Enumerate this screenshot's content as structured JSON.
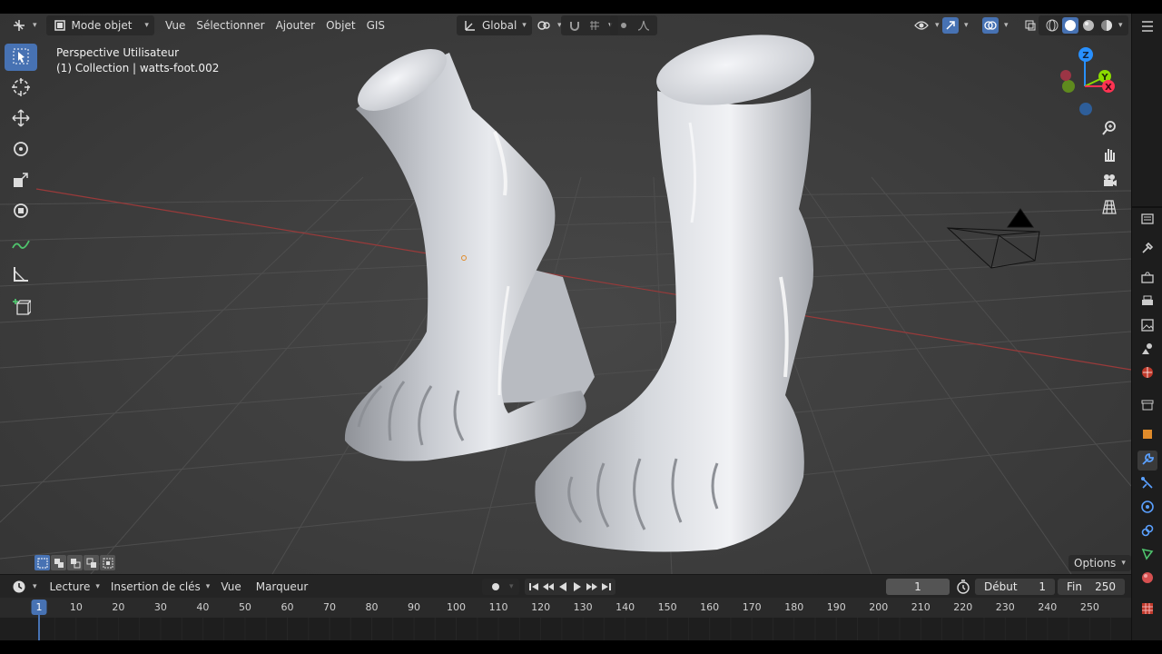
{
  "header": {
    "editor_type_icon": "axis-editor-icon",
    "mode_label": "Mode objet",
    "menus": [
      "Vue",
      "Sélectionner",
      "Ajouter",
      "Objet",
      "GIS"
    ],
    "transform_orientation": "Global"
  },
  "viewport": {
    "view_name": "Perspective Utilisateur",
    "collection_info": "(1) Collection | watts-foot.002",
    "options_label": "Options",
    "gizmo_axes": {
      "z": "Z",
      "y": "Y",
      "x": "X"
    }
  },
  "toolbar": {
    "tools": [
      "select-box-icon",
      "cursor-icon",
      "move-icon",
      "rotate-icon",
      "scale-icon",
      "transform-icon",
      "annotate-icon",
      "measure-icon",
      "add-cube-icon"
    ]
  },
  "timeline": {
    "menus": [
      "Lecture",
      "Insertion de clés",
      "Vue",
      "Marqueur"
    ],
    "current_frame": "1",
    "start_label": "Début",
    "start_value": "1",
    "end_label": "Fin",
    "end_value": "250",
    "ruler_ticks": [
      "10",
      "20",
      "30",
      "40",
      "50",
      "60",
      "70",
      "80",
      "90",
      "100",
      "110",
      "120",
      "130",
      "140",
      "150",
      "160",
      "170",
      "180",
      "190",
      "200",
      "210",
      "220",
      "230",
      "240",
      "250"
    ],
    "current_frame_marker": "1"
  },
  "colors": {
    "accent": "#4772b3",
    "axis_x": "#ff3352",
    "axis_y": "#8bdc00",
    "axis_z": "#2890ff",
    "panel_bg": "#1d1d1d"
  }
}
